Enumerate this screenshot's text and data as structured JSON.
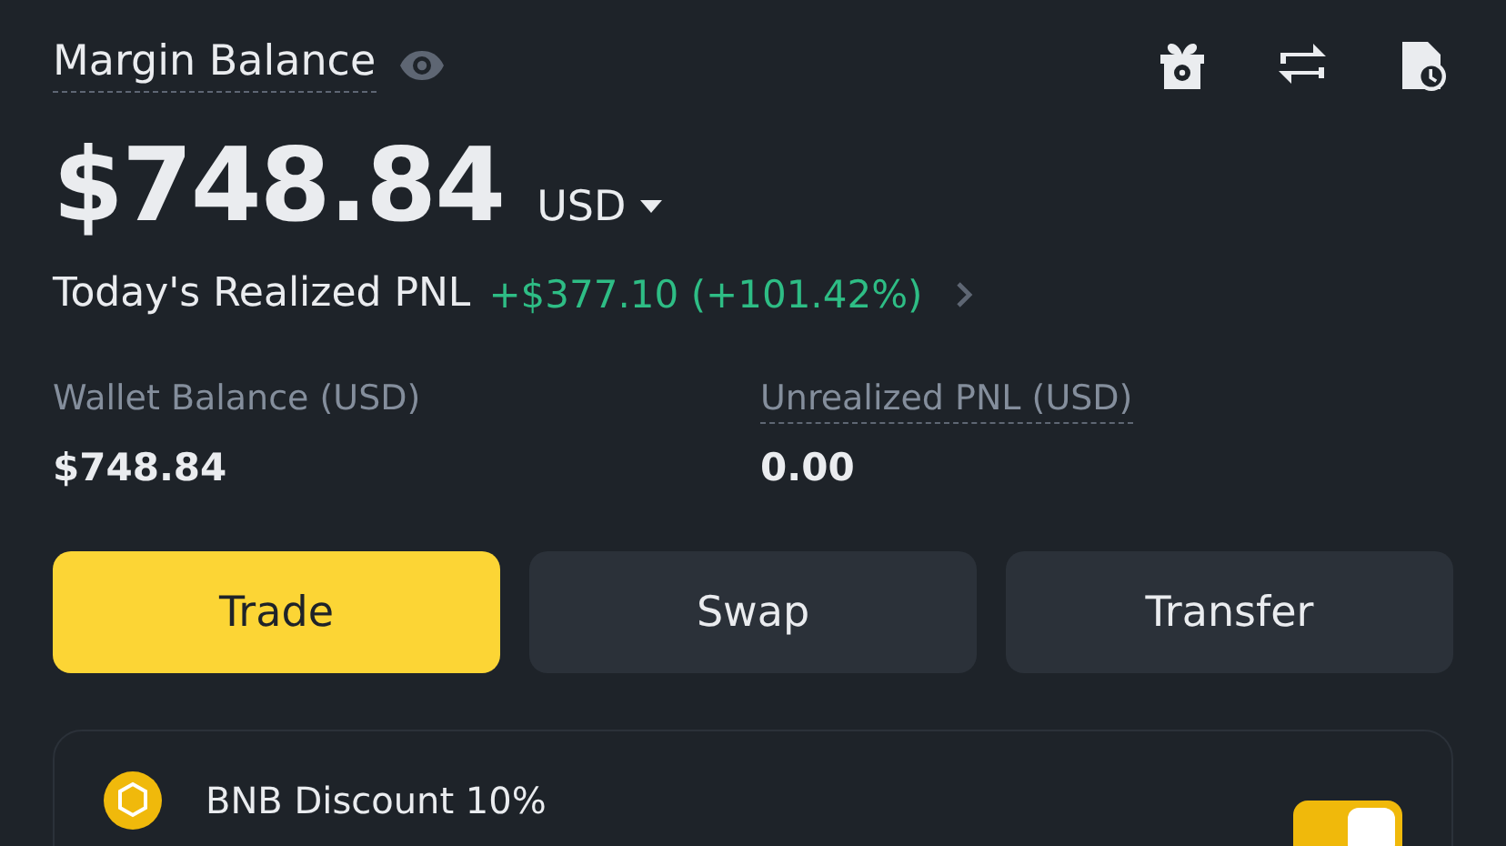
{
  "header": {
    "title": "Margin Balance",
    "balance": "$748.84",
    "currency": "USD"
  },
  "pnl": {
    "label": "Today's Realized PNL",
    "value": "+$377.10 (+101.42%)"
  },
  "stats": [
    {
      "label": "Wallet Balance (USD)",
      "value": "$748.84",
      "dotted": false
    },
    {
      "label": "Unrealized PNL (USD)",
      "value": "0.00",
      "dotted": true
    }
  ],
  "buttons": [
    {
      "label": "Trade",
      "selected": true
    },
    {
      "label": "Swap",
      "selected": false
    },
    {
      "label": "Transfer",
      "selected": false
    }
  ],
  "discount": {
    "label": "BNB Discount 10%",
    "on": true
  }
}
